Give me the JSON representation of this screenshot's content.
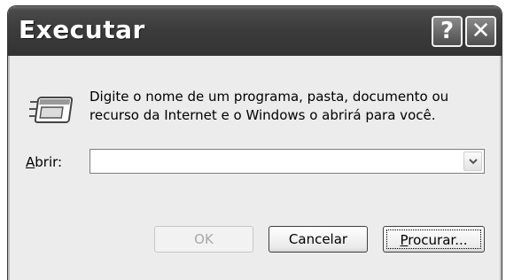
{
  "window": {
    "title": "Executar",
    "help_label": "?",
    "close_label": "✕"
  },
  "content": {
    "description_line1": "Digite o nome de um programa, pasta, documento ou",
    "description_line2": "recurso da Internet e o Windows o abrirá para você.",
    "open_label_accel": "A",
    "open_label_rest": "brir:",
    "open_value": "",
    "icon": "run-window-icon"
  },
  "buttons": {
    "ok": "OK",
    "cancel": "Cancelar",
    "browse_accel": "P",
    "browse_rest": "rocurar..."
  }
}
